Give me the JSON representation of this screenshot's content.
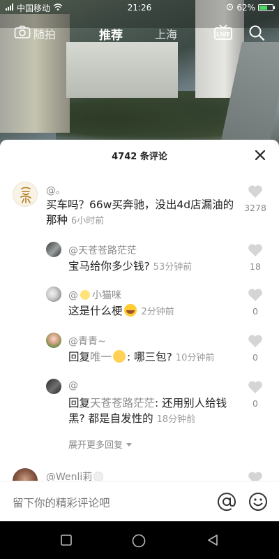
{
  "status_bar": {
    "carrier": "中国移动",
    "time": "21:26",
    "battery": "62%",
    "battery_level": 0.62
  },
  "top_nav": {
    "camera_label": "随拍",
    "tabs": [
      "推荐",
      "上海"
    ],
    "active_tab": "推荐",
    "live_label": "LIVE"
  },
  "sheet": {
    "title": "4742 条评论"
  },
  "comments": [
    {
      "user": "@。",
      "text": "买车吗？66w买奔驰，没出4d店漏油的那种",
      "time": "6小时前",
      "likes": "3278"
    },
    {
      "user": "@天苍苍路茫茫",
      "text": "宝马给你多少钱?",
      "time": "53分钟前",
      "likes": "18"
    },
    {
      "user": "@",
      "user_suffix": "小猫咪",
      "text": "这是什么梗",
      "time": "2分钟前",
      "likes": "0"
    },
    {
      "user": "@青青~",
      "reply_prefix": "回复",
      "reply_to": "唯一",
      "text": ": 哪三包?",
      "time": "10分钟前",
      "likes": "0"
    },
    {
      "user": "@",
      "reply_prefix": "回复",
      "reply_to": "天苍苍路茫茫",
      "text": ": 还用别人给钱黑? 都是自发性的",
      "time": "18分钟前",
      "likes": "0"
    },
    {
      "user": "@Wenli莉"
    }
  ],
  "expand_label": "展开更多回复",
  "input": {
    "placeholder": "留下你的精彩评论吧"
  },
  "colors": {
    "accent_battery": "#4cd964",
    "text_main": "#222222",
    "text_muted": "#8a8a8a"
  }
}
